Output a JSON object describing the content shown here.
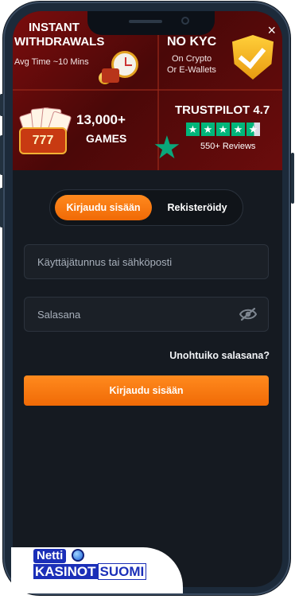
{
  "banner": {
    "close_symbol": "×",
    "tile1": {
      "title_line1": "INSTANT",
      "title_line2": "WITHDRAWALS",
      "subtitle": "Avg Time ~10 Mins"
    },
    "tile2": {
      "title": "NO KYC",
      "subtitle_line1": "On Crypto",
      "subtitle_line2": "Or E-Wallets"
    },
    "tile3": {
      "title_line1": "13,000+",
      "title_line2": "GAMES",
      "slot_text": "777"
    },
    "tile4": {
      "title": "TRUSTPILOT 4.7",
      "reviews": "550+ Reviews",
      "rating": 4.7
    }
  },
  "auth": {
    "tab_login": "Kirjaudu sisään",
    "tab_register": "Rekisteröidy",
    "username_placeholder": "Käyttäjätunnus tai sähköposti",
    "password_placeholder": "Salasana",
    "forgot_password": "Unohtuiko salasana?",
    "submit": "Kirjaudu sisään"
  },
  "watermark": {
    "line1": "Netti",
    "line2a": "KASINOT",
    "line2b": "SUOMI"
  },
  "colors": {
    "accent": "#f57a0f",
    "background": "#151a21",
    "banner": "#5a0a0a",
    "trustpilot": "#00b67a"
  },
  "icons": {
    "close": "close-icon",
    "eye": "eye-slash-icon",
    "shield": "shield-check-icon",
    "clock": "stopwatch-icon",
    "star": "star-icon"
  }
}
